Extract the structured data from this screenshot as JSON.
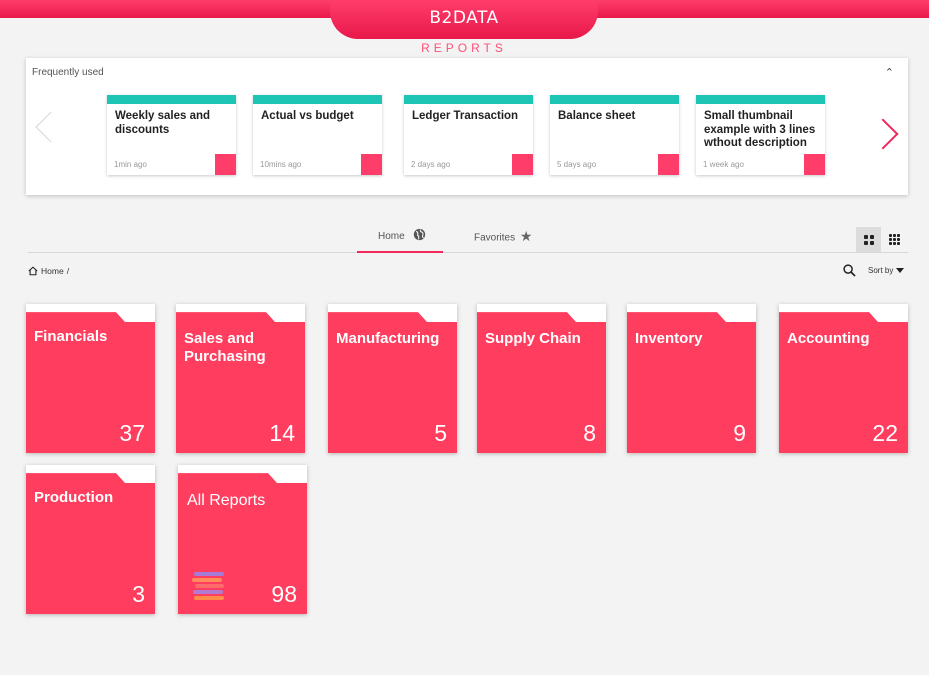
{
  "header": {
    "brand": "B2DATA",
    "subtitle": "REPORTS"
  },
  "frequently_used": {
    "title": "Frequently used",
    "cards": [
      {
        "title": "Weekly sales and discounts",
        "time": "1min ago"
      },
      {
        "title": "Actual vs budget",
        "time": "10mins ago"
      },
      {
        "title": "Ledger Transaction",
        "time": "2 days ago"
      },
      {
        "title": "Balance sheet",
        "time": "5 days ago"
      },
      {
        "title": "Small thumbnail example with 3 lines wthout description",
        "time": "1 week ago"
      }
    ]
  },
  "tabs": {
    "home": "Home",
    "favorites": "Favorites"
  },
  "breadcrumb": {
    "home": "Home",
    "separator": "/"
  },
  "toolbar": {
    "sort_label": "Sort by"
  },
  "folders": [
    {
      "name": "Financials",
      "count": "37"
    },
    {
      "name": "Sales and Purchasing",
      "count": "14"
    },
    {
      "name": "Manufacturing",
      "count": "5"
    },
    {
      "name": "Supply Chain",
      "count": "8"
    },
    {
      "name": "Inventory",
      "count": "9"
    },
    {
      "name": "Accounting",
      "count": "22"
    },
    {
      "name": "Production",
      "count": "3"
    },
    {
      "name": "All Reports",
      "count": "98"
    }
  ],
  "colors": {
    "accent": "#f0285c",
    "folder": "#ff3d5e",
    "card_top": "#1ec4b4"
  }
}
